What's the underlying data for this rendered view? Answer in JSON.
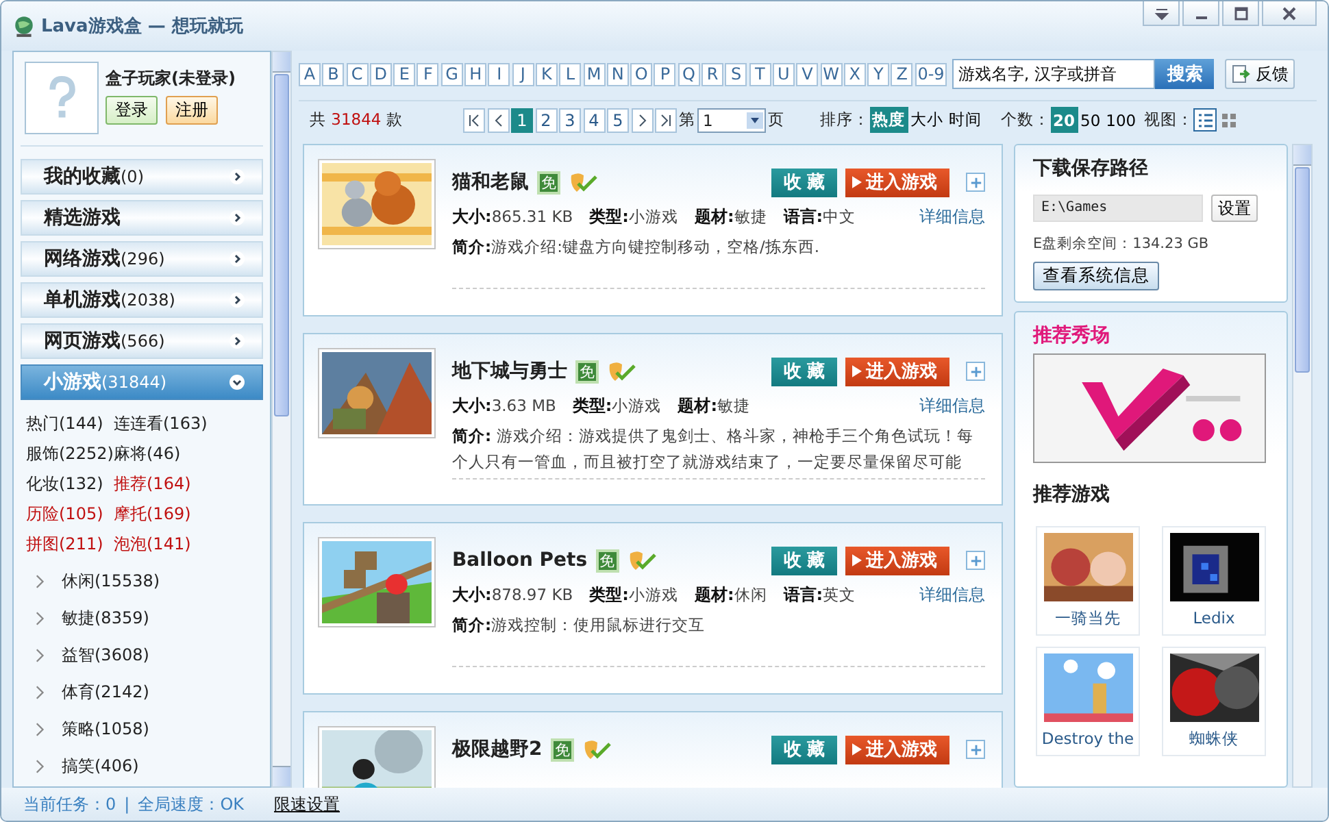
{
  "window": {
    "title": "Lava游戏盒 — 想玩就玩"
  },
  "user": {
    "name": "盒子玩家(未登录)",
    "login": "登录",
    "register": "注册"
  },
  "nav": [
    {
      "label": "我的收藏",
      "count": "(0)",
      "selected": false
    },
    {
      "label": "精选游戏",
      "selected": false
    },
    {
      "label": "网络游戏",
      "count": "(296)",
      "selected": false
    },
    {
      "label": "单机游戏",
      "count": "(2038)",
      "selected": false
    },
    {
      "label": "网页游戏",
      "count": "(566)",
      "selected": false
    },
    {
      "label": "小游戏",
      "count": "(31844)",
      "selected": true
    }
  ],
  "subcategories": [
    {
      "label": "热门(144)",
      "highlighted": false
    },
    {
      "label": "连连看(163)",
      "highlighted": false
    },
    {
      "label": "服饰(2252)",
      "highlighted": false
    },
    {
      "label": "麻将(46)",
      "highlighted": false
    },
    {
      "label": "化妆(132)",
      "highlighted": false
    },
    {
      "label": "推荐(164)",
      "highlighted": true
    },
    {
      "label": "历险(105)",
      "highlighted": true
    },
    {
      "label": "摩托(169)",
      "highlighted": true
    },
    {
      "label": "拼图(211)",
      "highlighted": true
    },
    {
      "label": "泡泡(141)",
      "highlighted": true
    }
  ],
  "tree": [
    {
      "label": "休闲(15538)"
    },
    {
      "label": "敏捷(8359)"
    },
    {
      "label": "益智(3608)"
    },
    {
      "label": "体育(2142)"
    },
    {
      "label": "策略(1058)"
    },
    {
      "label": "搞笑(406)"
    }
  ],
  "letters": [
    "A",
    "B",
    "C",
    "D",
    "E",
    "F",
    "G",
    "H",
    "I",
    "J",
    "K",
    "L",
    "M",
    "N",
    "O",
    "P",
    "Q",
    "R",
    "S",
    "T",
    "U",
    "V",
    "W",
    "X",
    "Y",
    "Z",
    "0-9"
  ],
  "search": {
    "placeholder": "游戏名字, 汉字或拼音",
    "button": "搜索"
  },
  "feedback": "反馈",
  "total": {
    "prefix": "共",
    "count": "31844",
    "suffix": "款"
  },
  "pages": [
    {
      "label": "1",
      "selected": true
    },
    {
      "label": "2",
      "selected": false
    },
    {
      "label": "3",
      "selected": false
    },
    {
      "label": "4",
      "selected": false
    },
    {
      "label": "5",
      "selected": false
    }
  ],
  "page_jump": {
    "prefix": "第",
    "value": "1",
    "suffix": "页"
  },
  "sort": {
    "label": "排序：",
    "options": [
      {
        "label": "热度",
        "selected": true
      },
      {
        "label": "大小",
        "selected": false
      },
      {
        "label": "时间",
        "selected": false
      }
    ]
  },
  "per_page": {
    "label": "个数：",
    "options": [
      {
        "label": "20",
        "selected": true
      },
      {
        "label": "50",
        "selected": false
      },
      {
        "label": "100",
        "selected": false
      }
    ]
  },
  "view": {
    "label": "视图：",
    "options": [
      {
        "kind": "list",
        "selected": true
      },
      {
        "kind": "grid",
        "selected": false
      }
    ]
  },
  "games": [
    {
      "title": "猫和老鼠",
      "badge": "免",
      "favorite": "收藏",
      "play": "进入游戏",
      "details": "详细信息",
      "meta": [
        {
          "label": "大小:",
          "value": "865.31 KB"
        },
        {
          "label": "类型:",
          "value": "小游戏"
        },
        {
          "label": "题材:",
          "value": "敏捷"
        },
        {
          "label": "语言:",
          "value": "中文"
        }
      ],
      "desc_label": "简介:",
      "desc": "游戏介绍:键盘方向键控制移动，空格/拣东西."
    },
    {
      "title": "地下城与勇士",
      "badge": "免",
      "favorite": "收藏",
      "play": "进入游戏",
      "details": "详细信息",
      "meta": [
        {
          "label": "大小:",
          "value": "3.63 MB"
        },
        {
          "label": "类型:",
          "value": "小游戏"
        },
        {
          "label": "题材:",
          "value": "敏捷"
        }
      ],
      "desc_label": "简介:",
      "desc": " 游戏介绍：游戏提供了鬼剑士、格斗家，神枪手三个角色试玩！每个人只有一管血，而且被打空了就游戏结束了，一定要尽量保留尽可能"
    },
    {
      "title": "Balloon Pets",
      "badge": "免",
      "favorite": "收藏",
      "play": "进入游戏",
      "details": "详细信息",
      "meta": [
        {
          "label": "大小:",
          "value": "878.97 KB"
        },
        {
          "label": "类型:",
          "value": "小游戏"
        },
        {
          "label": "题材:",
          "value": "休闲"
        },
        {
          "label": "语言:",
          "value": "英文"
        }
      ],
      "desc_label": "简介:",
      "desc": "游戏控制：使用鼠标进行交互"
    },
    {
      "title": "极限越野2",
      "badge": "免",
      "favorite": "收藏",
      "play": "进入游戏"
    }
  ],
  "download": {
    "title": "下载保存路径",
    "path": "E:\\Games",
    "set_button": "设置",
    "free_space": "E盘剩余空间：134.23 GB",
    "info_button": "查看系统信息"
  },
  "promo": {
    "title": "推荐秀场"
  },
  "recommended": {
    "title": "推荐游戏",
    "items": [
      {
        "name": "一骑当先"
      },
      {
        "name": "Ledix"
      },
      {
        "name": "Destroy the"
      },
      {
        "name": "蜘蛛侠"
      }
    ]
  },
  "status_bar": {
    "task": "当前任务：0",
    "separator": "|",
    "speed": "全局速度：OK",
    "link": "限速设置"
  }
}
